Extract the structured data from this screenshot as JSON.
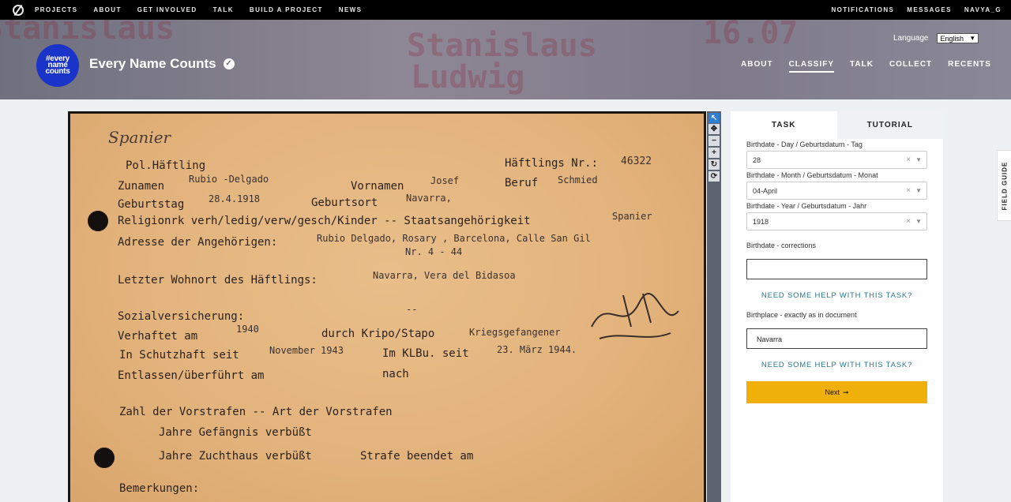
{
  "topnav": {
    "links": [
      "PROJECTS",
      "ABOUT",
      "GET INVOLVED",
      "TALK",
      "BUILD A PROJECT",
      "NEWS"
    ],
    "right": [
      "NOTIFICATIONS",
      "MESSAGES",
      "NAVYA_G"
    ]
  },
  "project": {
    "avatar_lines": [
      "#every",
      "name",
      "counts"
    ],
    "title": "Every Name Counts",
    "language_label": "Language",
    "language_value": "English",
    "nav": [
      "ABOUT",
      "CLASSIFY",
      "TALK",
      "COLLECT",
      "RECENTS"
    ],
    "active_nav": "CLASSIFY",
    "banner_bg_words": [
      "Stanislaus",
      "Ludwig",
      "16.07"
    ]
  },
  "document": {
    "header_script": "Spanier",
    "pol": "Pol.Häftling",
    "haeftlings_nr_label": "Häftlings Nr.:",
    "haeftlings_nr": "46322",
    "zuname_label": "Zunamen",
    "zuname": "Rubio -Delgado",
    "vorname_label": "Vornamen",
    "vorname": "Josef",
    "beruf_label": "Beruf",
    "beruf": "Schmied",
    "geburtstag_label": "Geburtstag",
    "geburtstag": "28.4.1918",
    "geburtsort_label": "Geburtsort",
    "geburtsort": "Navarra,",
    "religion_line": "Religionrk verh/ledig/verw/gesch/Kinder -- Staatsangehörigkeit",
    "staat": "Spanier",
    "adresse_label": "Adresse der Angehörigen:",
    "adresse": "Rubio Delgado, Rosary , Barcelona, Calle San Gil",
    "adresse2": "Nr. 4 - 44",
    "wohnort_label": "Letzter Wohnort des Häftlings:",
    "wohnort": "Navarra, Vera del Bidasoa",
    "sozial_label": "Sozialversicherung:",
    "sozial": "--",
    "verhaftet_line": "Verhaftet am",
    "verhaftet": "1940",
    "durch": "durch Kripo/Stapo",
    "durch_fill": "Kriegsgefangener",
    "schutzhaft_label": "In Schutzhaft seit",
    "schutzhaft": "November 1943",
    "klbu_label": "Im KLBu. seit",
    "klbu": "23. März 1944.",
    "entlassen": "Entlassen/überführt am",
    "nach": "nach",
    "vorstrafen": "Zahl der Vorstrafen -- Art der Vorstrafen",
    "gefaengnis": "Jahre Gefängnis verbüßt",
    "zuchthaus": "Jahre Zuchthaus verbüßt",
    "strafe": "Strafe beendet am",
    "bemerkungen": "Bemerkungen:"
  },
  "tools": {
    "icons": [
      "pointer-icon",
      "move-icon",
      "zoom-out-icon",
      "zoom-in-icon",
      "rotate-icon",
      "reset-icon"
    ]
  },
  "panel": {
    "tabs": [
      "TASK",
      "TUTORIAL"
    ],
    "day_label": "Birthdate - Day / Geburtsdatum - Tag",
    "day_value": "28",
    "month_label": "Birthdate - Month / Geburtsdatum - Monat",
    "month_value": "04-April",
    "year_label": "Birthdate - Year / Geburtsdatum - Jahr",
    "year_value": "1918",
    "corrections_label": "Birthdate - corrections",
    "corrections_value": "",
    "help1": "NEED SOME HELP WITH THIS TASK?",
    "birthplace_label": "Birthplace - exactly as in document",
    "birthplace_value": "Navarra",
    "help2": "NEED SOME HELP WITH THIS TASK?",
    "next_label": "Next",
    "next_arrow": "➞"
  },
  "field_guide": "FIELD GUIDE"
}
